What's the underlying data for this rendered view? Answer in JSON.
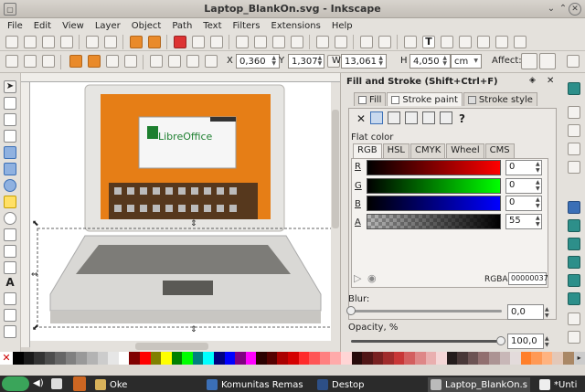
{
  "window": {
    "title": "Laptop_BlankOn.svg - Inkscape"
  },
  "menu": [
    "File",
    "Edit",
    "View",
    "Layer",
    "Object",
    "Path",
    "Text",
    "Filters",
    "Extensions",
    "Help"
  ],
  "toolctrl": {
    "x_label": "X",
    "x_value": "0,360",
    "y_label": "Y",
    "y_value": "1,307",
    "w_label": "W",
    "w_value": "13,061",
    "h_label": "H",
    "h_value": "4,050",
    "unit": "cm",
    "affect_label": "Affect:"
  },
  "dock": {
    "title": "Fill and Stroke (Shift+Ctrl+F)",
    "tabs": [
      "Fill",
      "Stroke paint",
      "Stroke style"
    ],
    "paint_label": "Flat color",
    "color_tabs": [
      "RGB",
      "HSL",
      "CMYK",
      "Wheel",
      "CMS"
    ],
    "channels": [
      {
        "label": "R",
        "value": "0"
      },
      {
        "label": "G",
        "value": "0"
      },
      {
        "label": "B",
        "value": "0"
      },
      {
        "label": "A",
        "value": "55"
      }
    ],
    "rgba_label": "RGBA:",
    "rgba_value": "00000037",
    "blur_label": "Blur:",
    "blur_value": "0,0",
    "opacity_label": "Opacity, %",
    "opacity_value": "100,0",
    "unknown_label": "?"
  },
  "screen": {
    "logo_text": "LibreOffice"
  },
  "taskbar": {
    "items": [
      "Oke",
      "Komunitas Remas",
      "Destop",
      "Laptop_BlankOn.s",
      "*Unti"
    ]
  },
  "colors": {
    "accent": "#e98a2a",
    "screen_orange": "#e67e16"
  }
}
